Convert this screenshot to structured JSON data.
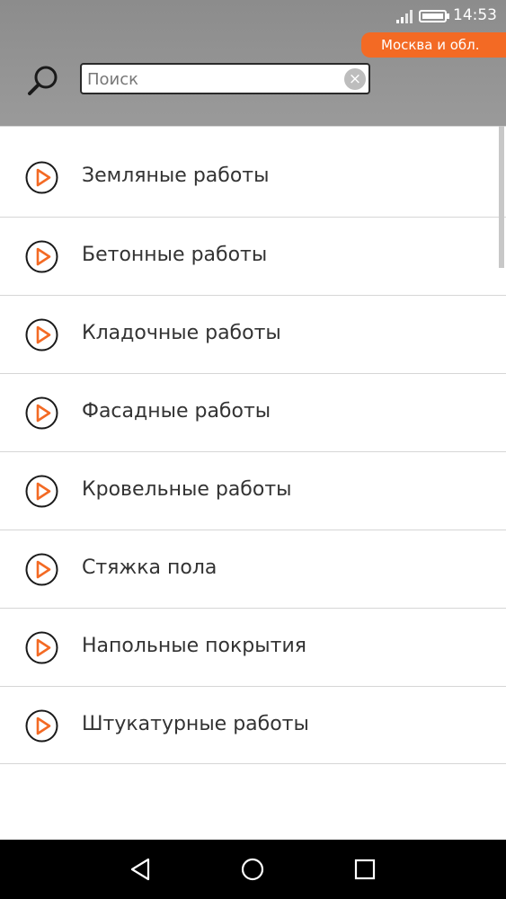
{
  "status_bar": {
    "time": "14:53"
  },
  "region": {
    "label": "Москва и обл."
  },
  "search": {
    "placeholder": "Поиск",
    "value": "",
    "clear_glyph": "×"
  },
  "categories": [
    {
      "label": "Земляные работы"
    },
    {
      "label": "Бетонные работы"
    },
    {
      "label": "Кладочные работы"
    },
    {
      "label": "Фасадные работы"
    },
    {
      "label": "Кровельные работы"
    },
    {
      "label": "Стяжка пола"
    },
    {
      "label": "Напольные покрытия"
    },
    {
      "label": "Штукатурные работы"
    }
  ],
  "icons": {
    "search": "search-icon",
    "item": "play-circle-icon",
    "nav": [
      "back-icon",
      "home-icon",
      "recents-icon"
    ]
  },
  "colors": {
    "accent": "#f36a24",
    "header": "#939393",
    "text": "#333333"
  }
}
